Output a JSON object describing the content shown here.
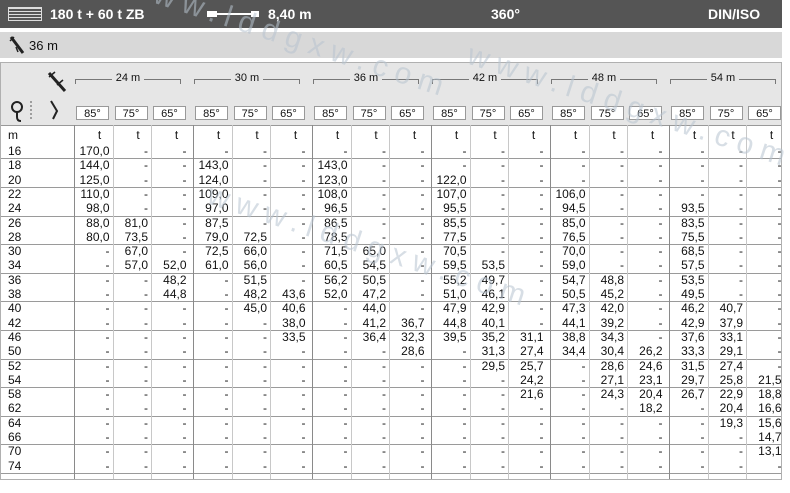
{
  "header": {
    "config": "180 t + 60 t ZB",
    "radius_extension": "8,40 m",
    "slew": "360°",
    "standard": "DIN/ISO"
  },
  "subheader": {
    "boom": "36 m"
  },
  "table": {
    "jib_lengths": [
      "24 m",
      "30 m",
      "36 m",
      "42 m",
      "48 m",
      "54 m"
    ],
    "angles": [
      "85°",
      "75°",
      "65°"
    ],
    "row_unit": "m",
    "col_unit": "t",
    "rows": [
      {
        "r": "16",
        "v": [
          "170,0",
          "-",
          "-",
          "-",
          "-",
          "-",
          "-",
          "-",
          "-",
          "-",
          "-",
          "-",
          "-",
          "-",
          "-",
          "-",
          "-",
          "-"
        ]
      },
      {
        "r": "18",
        "v": [
          "144,0",
          "-",
          "-",
          "143,0",
          "-",
          "-",
          "143,0",
          "-",
          "-",
          "-",
          "-",
          "-",
          "-",
          "-",
          "-",
          "-",
          "-",
          "-"
        ]
      },
      {
        "r": "20",
        "v": [
          "125,0",
          "-",
          "-",
          "124,0",
          "-",
          "-",
          "123,0",
          "-",
          "-",
          "122,0",
          "-",
          "-",
          "-",
          "-",
          "-",
          "-",
          "-",
          "-"
        ]
      },
      {
        "r": "22",
        "v": [
          "110,0",
          "-",
          "-",
          "109,0",
          "-",
          "-",
          "108,0",
          "-",
          "-",
          "107,0",
          "-",
          "-",
          "106,0",
          "-",
          "-",
          "-",
          "-",
          "-"
        ]
      },
      {
        "r": "24",
        "v": [
          "98,0",
          "-",
          "-",
          "97,0",
          "-",
          "-",
          "96,5",
          "-",
          "-",
          "95,5",
          "-",
          "-",
          "94,5",
          "-",
          "-",
          "93,5",
          "-",
          "-"
        ]
      },
      {
        "r": "26",
        "v": [
          "88,0",
          "81,0",
          "-",
          "87,5",
          "-",
          "-",
          "86,5",
          "-",
          "-",
          "85,5",
          "-",
          "-",
          "85,0",
          "-",
          "-",
          "83,5",
          "-",
          "-"
        ]
      },
      {
        "r": "28",
        "v": [
          "80,0",
          "73,5",
          "-",
          "79,0",
          "72,5",
          "-",
          "78,5",
          "-",
          "-",
          "77,5",
          "-",
          "-",
          "76,5",
          "-",
          "-",
          "75,5",
          "-",
          "-"
        ]
      },
      {
        "r": "30",
        "v": [
          "-",
          "67,0",
          "-",
          "72,5",
          "66,0",
          "-",
          "71,5",
          "65,0",
          "-",
          "70,5",
          "-",
          "-",
          "70,0",
          "-",
          "-",
          "68,5",
          "-",
          "-"
        ]
      },
      {
        "r": "34",
        "v": [
          "-",
          "57,0",
          "52,0",
          "61,0",
          "56,0",
          "-",
          "60,5",
          "54,5",
          "-",
          "59,5",
          "53,5",
          "-",
          "59,0",
          "-",
          "-",
          "57,5",
          "-",
          "-"
        ]
      },
      {
        "r": "36",
        "v": [
          "-",
          "-",
          "48,2",
          "-",
          "51,5",
          "-",
          "56,2",
          "50,5",
          "-",
          "55,2",
          "49,7",
          "-",
          "54,7",
          "48,8",
          "-",
          "53,5",
          "-",
          "-"
        ]
      },
      {
        "r": "38",
        "v": [
          "-",
          "-",
          "44,8",
          "-",
          "48,2",
          "43,6",
          "52,0",
          "47,2",
          "-",
          "51,0",
          "46,1",
          "-",
          "50,5",
          "45,2",
          "-",
          "49,5",
          "-",
          "-"
        ]
      },
      {
        "r": "40",
        "v": [
          "-",
          "-",
          "-",
          "-",
          "45,0",
          "40,6",
          "-",
          "44,0",
          "-",
          "47,9",
          "42,9",
          "-",
          "47,3",
          "42,0",
          "-",
          "46,2",
          "40,7",
          "-"
        ]
      },
      {
        "r": "42",
        "v": [
          "-",
          "-",
          "-",
          "-",
          "-",
          "38,0",
          "-",
          "41,2",
          "36,7",
          "44,8",
          "40,1",
          "-",
          "44,1",
          "39,2",
          "-",
          "42,9",
          "37,9",
          "-"
        ]
      },
      {
        "r": "46",
        "v": [
          "-",
          "-",
          "-",
          "-",
          "-",
          "33,5",
          "-",
          "36,4",
          "32,3",
          "39,5",
          "35,2",
          "31,1",
          "38,8",
          "34,3",
          "-",
          "37,6",
          "33,1",
          "-"
        ]
      },
      {
        "r": "50",
        "v": [
          "-",
          "-",
          "-",
          "-",
          "-",
          "-",
          "-",
          "-",
          "28,6",
          "-",
          "31,3",
          "27,4",
          "34,4",
          "30,4",
          "26,2",
          "33,3",
          "29,1",
          "-"
        ]
      },
      {
        "r": "52",
        "v": [
          "-",
          "-",
          "-",
          "-",
          "-",
          "-",
          "-",
          "-",
          "-",
          "-",
          "29,5",
          "25,7",
          "-",
          "28,6",
          "24,6",
          "31,5",
          "27,4",
          "-"
        ]
      },
      {
        "r": "54",
        "v": [
          "-",
          "-",
          "-",
          "-",
          "-",
          "-",
          "-",
          "-",
          "-",
          "-",
          "-",
          "24,2",
          "-",
          "27,1",
          "23,1",
          "29,7",
          "25,8",
          "21,5"
        ]
      },
      {
        "r": "58",
        "v": [
          "-",
          "-",
          "-",
          "-",
          "-",
          "-",
          "-",
          "-",
          "-",
          "-",
          "-",
          "21,6",
          "-",
          "24,3",
          "20,4",
          "26,7",
          "22,9",
          "18,8"
        ]
      },
      {
        "r": "62",
        "v": [
          "-",
          "-",
          "-",
          "-",
          "-",
          "-",
          "-",
          "-",
          "-",
          "-",
          "-",
          "-",
          "-",
          "-",
          "18,2",
          "-",
          "20,4",
          "16,6"
        ]
      },
      {
        "r": "64",
        "v": [
          "-",
          "-",
          "-",
          "-",
          "-",
          "-",
          "-",
          "-",
          "-",
          "-",
          "-",
          "-",
          "-",
          "-",
          "-",
          "-",
          "19,3",
          "15,6"
        ]
      },
      {
        "r": "66",
        "v": [
          "-",
          "-",
          "-",
          "-",
          "-",
          "-",
          "-",
          "-",
          "-",
          "-",
          "-",
          "-",
          "-",
          "-",
          "-",
          "-",
          "-",
          "14,7"
        ]
      },
      {
        "r": "70",
        "v": [
          "-",
          "-",
          "-",
          "-",
          "-",
          "-",
          "-",
          "-",
          "-",
          "-",
          "-",
          "-",
          "-",
          "-",
          "-",
          "-",
          "-",
          "13,1"
        ]
      },
      {
        "r": "74",
        "v": [
          "-",
          "-",
          "-",
          "-",
          "-",
          "-",
          "-",
          "-",
          "-",
          "-",
          "-",
          "-",
          "-",
          "-",
          "-",
          "-",
          "-",
          "-"
        ]
      }
    ]
  },
  "watermark": "www.lddgxw.com"
}
